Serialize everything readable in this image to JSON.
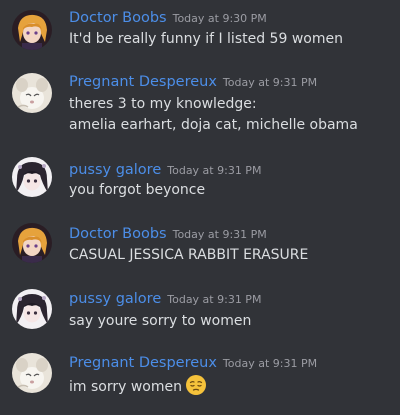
{
  "messages": [
    {
      "username": "Doctor Boobs",
      "timestamp": "Today at 9:30 PM",
      "lines": [
        "It'd be really funny if I listed 59 women"
      ],
      "avatar": "anime-orange-hair-avatar-icon"
    },
    {
      "username": "Pregnant Despereux",
      "timestamp": "Today at 9:31 PM",
      "lines": [
        "theres 3 to my knowledge:",
        "amelia earhart, doja cat, michelle obama"
      ],
      "avatar": "white-mouse-avatar-icon"
    },
    {
      "username": "pussy galore",
      "timestamp": "Today at 9:31 PM",
      "lines": [
        "you forgot beyonce"
      ],
      "avatar": "anime-dark-hair-avatar-icon"
    },
    {
      "username": "Doctor Boobs",
      "timestamp": "Today at 9:31 PM",
      "lines": [
        "CASUAL JESSICA RABBIT ERASURE"
      ],
      "avatar": "anime-orange-hair-avatar-icon"
    },
    {
      "username": "pussy galore",
      "timestamp": "Today at 9:31 PM",
      "lines": [
        "say youre sorry to women"
      ],
      "avatar": "anime-dark-hair-avatar-icon"
    },
    {
      "username": "Pregnant Despereux",
      "timestamp": "Today at 9:31 PM",
      "lines": [
        "im sorry women"
      ],
      "avatar": "white-mouse-avatar-icon",
      "emoji": "pensive-face-emoji-icon"
    }
  ],
  "colors": {
    "background": "#313338",
    "username": "#4c8ee8",
    "timestamp": "#9b9ca3",
    "message_text": "#dbdee1",
    "emoji": "#f5c23b"
  }
}
